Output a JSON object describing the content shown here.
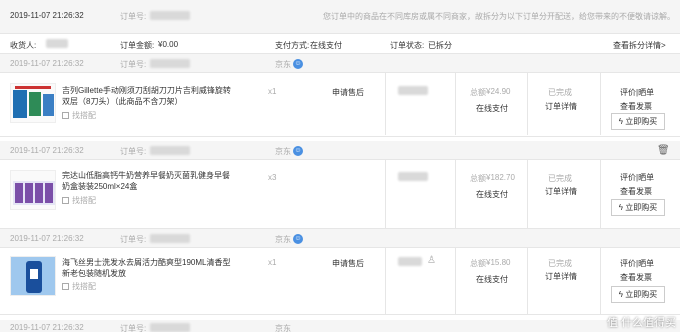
{
  "top_order": {
    "date": "2019-11-07 21:26:32",
    "order_no_label": "订单号:",
    "notice": "您订单中的商品在不同库房或属不同商家，故拆分为以下订单分开配送，给您带来的不便敬请谅解。",
    "receiver_label": "收货人:",
    "amount_label": "订单金额:",
    "amount_value": "¥0.00",
    "payment_label": "支付方式:",
    "payment_value": "在线支付",
    "status_label": "订单状态:",
    "status_value": "已拆分",
    "view_split_link": "查看拆分详情>"
  },
  "orders": [
    {
      "date": "2019-11-07 21:26:32",
      "order_no_label": "订单号:",
      "shop": "京东",
      "product_name": "吉列Gillette手动刚须刀刮胡刀刀片吉利威锋旋转双层（8刀头）（此商品不含刀架）",
      "find_similar": "找搭配",
      "qty": "x1",
      "after_sale": "申请售后",
      "total_label": "总额",
      "total_value": "¥24.90",
      "pay_method": "在线支付",
      "state": "已完成",
      "detail_link": "订单详情",
      "review_link": "评价|晒单",
      "invoice_link": "查看发票",
      "buy_label": "立即购买",
      "has_after_sale": false,
      "img_colors": [
        "#1f6fb2",
        "#2e8b57"
      ]
    },
    {
      "date": "2019-11-07 21:26:32",
      "order_no_label": "订单号:",
      "shop": "京东",
      "product_name": "完达山低脂高钙牛奶营养早餐奶灭菌乳健身早餐奶盒装装250ml×24盒",
      "find_similar": "找搭配",
      "qty": "x3",
      "after_sale": "",
      "total_label": "总额",
      "total_value": "¥182.70",
      "pay_method": "在线支付",
      "state": "已完成",
      "detail_link": "订单详情",
      "review_link": "评价|晒单",
      "invoice_link": "查看发票",
      "buy_label": "立即购买",
      "has_after_sale": false,
      "img_colors": [
        "#7b4fa8",
        "#e5e5f5"
      ]
    },
    {
      "date": "2019-11-07 21:26:32",
      "order_no_label": "订单号:",
      "shop": "京东",
      "product_name": "海飞丝男士洗发水去屑活力酷爽型190ML清香型 新老包装随机发放",
      "find_similar": "找搭配",
      "qty": "x1",
      "after_sale": "申请售后",
      "total_label": "总额",
      "total_value": "¥15.80",
      "pay_method": "在线支付",
      "state": "已完成",
      "detail_link": "订单详情",
      "review_link": "评价|晒单",
      "invoice_link": "查看发票",
      "buy_label": "立即购买",
      "has_after_sale": true,
      "img_colors": [
        "#1a4f9c",
        "#9fc8ee"
      ]
    }
  ],
  "footer_row": {
    "date": "2019-11-07 21:26:32",
    "order_no_label": "订单号:",
    "shop": "京东"
  },
  "watermark": "值 什么值得买"
}
